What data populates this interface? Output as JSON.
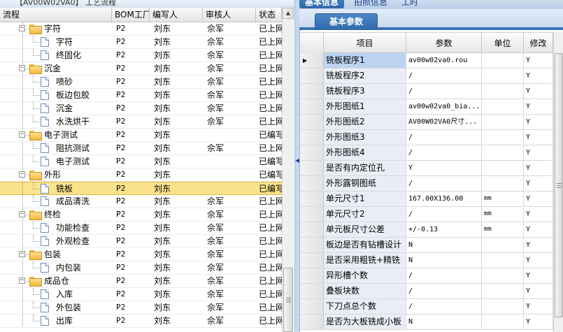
{
  "left_panel": {
    "title": "【AV00W02VA0】 工艺流程",
    "columns": [
      "流程",
      "BOM工厂",
      "编写人",
      "审核人",
      "状态"
    ],
    "rows": [
      {
        "name": "字符",
        "level": 0,
        "type": "folder",
        "bom": "P2",
        "writer": "刘东",
        "auditor": "佘军",
        "status": "已上网"
      },
      {
        "name": "字符",
        "level": 1,
        "type": "page",
        "bom": "P2",
        "writer": "刘东",
        "auditor": "佘军",
        "status": "已上网"
      },
      {
        "name": "终固化",
        "level": 1,
        "type": "page",
        "bom": "P2",
        "writer": "刘东",
        "auditor": "佘军",
        "status": "已上网"
      },
      {
        "name": "沉金",
        "level": 0,
        "type": "folder",
        "bom": "P2",
        "writer": "刘东",
        "auditor": "佘军",
        "status": "已上网"
      },
      {
        "name": "喷砂",
        "level": 1,
        "type": "page",
        "bom": "P2",
        "writer": "刘东",
        "auditor": "佘军",
        "status": "已上网"
      },
      {
        "name": "板边包胶",
        "level": 1,
        "type": "page",
        "bom": "P2",
        "writer": "刘东",
        "auditor": "佘军",
        "status": "已上网"
      },
      {
        "name": "沉金",
        "level": 1,
        "type": "page",
        "bom": "P2",
        "writer": "刘东",
        "auditor": "佘军",
        "status": "已上网"
      },
      {
        "name": "水洗烘干",
        "level": 1,
        "type": "page",
        "bom": "P2",
        "writer": "刘东",
        "auditor": "佘军",
        "status": "已上网"
      },
      {
        "name": "电子测试",
        "level": 0,
        "type": "folder",
        "bom": "P2",
        "writer": "刘东",
        "auditor": "",
        "status": "已编写"
      },
      {
        "name": "阻抗测试",
        "level": 1,
        "type": "page",
        "bom": "P2",
        "writer": "刘东",
        "auditor": "佘军",
        "status": "已上网"
      },
      {
        "name": "电子测试",
        "level": 1,
        "type": "page",
        "bom": "P2",
        "writer": "刘东",
        "auditor": "",
        "status": "已编写"
      },
      {
        "name": "外形",
        "level": 0,
        "type": "folder",
        "bom": "P2",
        "writer": "刘东",
        "auditor": "",
        "status": "已编写"
      },
      {
        "name": "铣板",
        "level": 1,
        "type": "page",
        "bom": "P2",
        "writer": "刘东",
        "auditor": "",
        "status": "已编写",
        "selected": true
      },
      {
        "name": "成品清洗",
        "level": 1,
        "type": "page",
        "bom": "P2",
        "writer": "刘东",
        "auditor": "佘军",
        "status": "已上网"
      },
      {
        "name": "终检",
        "level": 0,
        "type": "folder",
        "bom": "P2",
        "writer": "刘东",
        "auditor": "佘军",
        "status": "已上网"
      },
      {
        "name": "功能检查",
        "level": 1,
        "type": "page",
        "bom": "P2",
        "writer": "刘东",
        "auditor": "佘军",
        "status": "已上网"
      },
      {
        "name": "外观检查",
        "level": 1,
        "type": "page",
        "bom": "P2",
        "writer": "刘东",
        "auditor": "佘军",
        "status": "已上网"
      },
      {
        "name": "包装",
        "level": 0,
        "type": "folder",
        "bom": "P2",
        "writer": "刘东",
        "auditor": "佘军",
        "status": "已上网"
      },
      {
        "name": "内包装",
        "level": 1,
        "type": "page",
        "bom": "P2",
        "writer": "刘东",
        "auditor": "佘军",
        "status": "已上网"
      },
      {
        "name": "成品仓",
        "level": 0,
        "type": "folder",
        "bom": "P2",
        "writer": "刘东",
        "auditor": "佘军",
        "status": "已上网"
      },
      {
        "name": "入库",
        "level": 1,
        "type": "page",
        "bom": "P2",
        "writer": "刘东",
        "auditor": "佘军",
        "status": "已上网"
      },
      {
        "name": "外包装",
        "level": 1,
        "type": "page",
        "bom": "P2",
        "writer": "刘东",
        "auditor": "佘军",
        "status": "已上网"
      },
      {
        "name": "出库",
        "level": 1,
        "type": "page",
        "bom": "P2",
        "writer": "刘东",
        "auditor": "佘军",
        "status": "已上网"
      }
    ]
  },
  "right_panel": {
    "top_tabs": [
      "基本信息",
      "拍照信息",
      "工时"
    ],
    "active_top_tab": 0,
    "sub_tab": "基本参数",
    "grid_columns": [
      "",
      "项目",
      "参数",
      "单位",
      "修改"
    ],
    "rows": [
      {
        "item": "铣板程序1",
        "param": "av00w02va0.rou",
        "unit": "",
        "mod": "Y"
      },
      {
        "item": "铣板程序2",
        "param": "/",
        "unit": "",
        "mod": "Y"
      },
      {
        "item": "铣板程序3",
        "param": "/",
        "unit": "",
        "mod": "Y"
      },
      {
        "item": "外形图纸1",
        "param": "av00w02va0_bia...",
        "unit": "",
        "mod": "Y"
      },
      {
        "item": "外形图纸2",
        "param": "AV00W02VA0尺寸...",
        "unit": "",
        "mod": "Y"
      },
      {
        "item": "外形图纸3",
        "param": "/",
        "unit": "",
        "mod": "Y"
      },
      {
        "item": "外形图纸4",
        "param": "/",
        "unit": "",
        "mod": "Y"
      },
      {
        "item": "是否有内定位孔",
        "param": "Y",
        "unit": "",
        "mod": "Y"
      },
      {
        "item": "外形露铜图纸",
        "param": "/",
        "unit": "",
        "mod": "Y"
      },
      {
        "item": "单元尺寸1",
        "param": "167.00X136.00",
        "unit": "mm",
        "mod": "Y"
      },
      {
        "item": "单元尺寸2",
        "param": "/",
        "unit": "mm",
        "mod": "Y"
      },
      {
        "item": "单元板尺寸公差",
        "param": "+/-0.13",
        "unit": "mm",
        "mod": "Y"
      },
      {
        "item": "板边是否有钻槽设计",
        "param": "N",
        "unit": "",
        "mod": "Y"
      },
      {
        "item": "是否采用粗铣+精铣",
        "param": "N",
        "unit": "",
        "mod": "Y"
      },
      {
        "item": "异形槽个数",
        "param": "/",
        "unit": "",
        "mod": "Y"
      },
      {
        "item": "叠板块数",
        "param": "/",
        "unit": "",
        "mod": "Y"
      },
      {
        "item": "下刀点总个数",
        "param": "/",
        "unit": "",
        "mod": "Y"
      },
      {
        "item": "是否为大板铣成小板",
        "param": "N",
        "unit": "",
        "mod": "Y"
      }
    ]
  },
  "colors": {
    "selection": "#fbe38c",
    "tab_active": "#2d66a8",
    "item_cell": "#e9eef6",
    "item_cell_selected": "#bcd4f2"
  }
}
